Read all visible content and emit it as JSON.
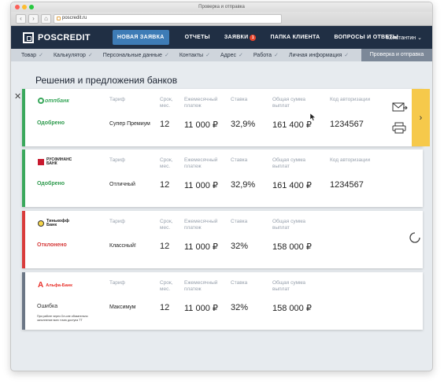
{
  "browser": {
    "window_title": "Проверка и отправка",
    "url": "poscredit.ru"
  },
  "site": {
    "logo_text": "POSCREDIT",
    "menu": {
      "new_request": "НОВАЯ ЗАЯВКА",
      "reports": "ОТЧЕТЫ",
      "requests": "ЗАЯВКИ",
      "requests_badge": "1",
      "client_folder": "ПАПКА КЛИЕНТА",
      "faq": "ВОПРОСЫ И ОТВЕТЫ"
    },
    "user_name": "Константин"
  },
  "steps": {
    "items": [
      "Товар",
      "Калькулятор",
      "Персональные данные",
      "Контакты",
      "Адрес",
      "Работа",
      "Личная информация"
    ],
    "active": "Проверка и отправка"
  },
  "page": {
    "heading": "Решения и предложения банков"
  },
  "labels": {
    "tariff": "Тариф",
    "term": "Срок,\nмес.",
    "monthly_payment": "Ежемесячный\nплатеж",
    "rate": "Ставка",
    "total_payment": "Общая сумма\nвыплат",
    "auth_code": "Код авторизации"
  },
  "offers": [
    {
      "bank": "ОТП Банк",
      "logo_text": "отпбанк",
      "status": "Одобрено",
      "status_color": "#2e9a4d",
      "tariff": "Супер Премиум",
      "term": "12",
      "monthly_payment": "11 000 ₽",
      "rate": "32,9%",
      "total_payment": "161 400 ₽",
      "auth_code": "1234567"
    },
    {
      "bank": "Русфинанс Банк",
      "logo_text": "РУСФИНАНС\nБАНК",
      "status": "Одобрено",
      "status_color": "#2e9a4d",
      "tariff": "Отличный",
      "term": "12",
      "monthly_payment": "11 000 ₽",
      "rate": "32,9%",
      "total_payment": "161 400 ₽",
      "auth_code": "1234567"
    },
    {
      "bank": "Тинькофф Банк",
      "logo_text": "Тинькофф\nБанк",
      "status": "Отклонено",
      "status_color": "#d63a3a",
      "tariff": "Классный!",
      "term": "12",
      "monthly_payment": "11 000 ₽",
      "rate": "32%",
      "total_payment": "158 000 ₽",
      "auth_code": ""
    },
    {
      "bank": "Альфа-Банк",
      "logo_text": "Альфа-Банк",
      "status": "Ошибка",
      "status_color": "#333333",
      "note": "При работе через Ол-оле обязательно заполнение всех точек доступа ТТ",
      "tariff": "Максимум",
      "term": "12",
      "monthly_payment": "11 000 ₽",
      "rate": "32%",
      "total_payment": "158 000 ₽",
      "auth_code": ""
    }
  ],
  "icons": {
    "close": "close-icon",
    "email": "envelope-arrow-icon",
    "print": "printer-icon",
    "next": "chevron-right-icon",
    "loading": "spinner-icon"
  },
  "colors": {
    "header_bg": "#202f44",
    "accent_blue": "#3e7cb6",
    "approved": "#3aa85c",
    "declined": "#d93b3b",
    "action_panel": "#f6c94b"
  }
}
